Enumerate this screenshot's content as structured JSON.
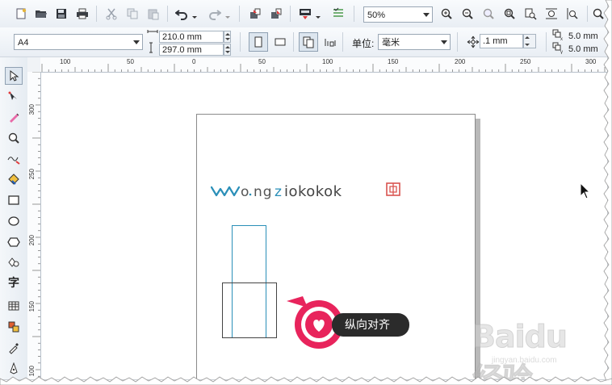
{
  "toolbar1": {
    "zoom_value": "50%",
    "icons": [
      "new-document-icon",
      "open-icon",
      "save-icon",
      "print-icon",
      "cut-icon",
      "copy-icon",
      "paste-icon",
      "undo-icon",
      "redo-icon",
      "import-icon",
      "export-icon",
      "app-launcher-icon",
      "options-icon",
      "zoom-in-icon",
      "zoom-out-icon",
      "zoom-selected-icon",
      "zoom-all-icon",
      "zoom-page-icon",
      "zoom-width-icon",
      "zoom-height-icon"
    ]
  },
  "toolbar2": {
    "paper_size": "A4",
    "width_value": "210.0 mm",
    "height_value": "297.0 mm",
    "units_label": "单位:",
    "units_value": "毫米",
    "nudge_value": ".1 mm",
    "dup_x_value": "5.0 mm",
    "dup_y_value": "5.0 mm"
  },
  "ruler_h": {
    "ticks": [
      "100",
      "50",
      "0",
      "50",
      "100",
      "150",
      "200",
      "250",
      "300"
    ]
  },
  "ruler_v": {
    "ticks": [
      "300",
      "250",
      "200",
      "150",
      "100"
    ]
  },
  "toolbox": {
    "tools": [
      "pick-tool-icon",
      "shape-tool-icon",
      "smart-fill-icon",
      "zoom-tool-icon",
      "freehand-tool-icon",
      "fill-tool-icon",
      "rectangle-tool-icon",
      "ellipse-tool-icon",
      "polygon-tool-icon",
      "shape-group-icon",
      "text-tool-icon",
      "table-tool-icon",
      "interactive-tool-icon",
      "eyedropper-tool-icon",
      "outline-tool-icon"
    ],
    "text_tool_glyph": "字"
  },
  "canvas": {
    "watermark_text": "wongziokokok",
    "tooltip_label": "纵向对齐",
    "baidu_main": "Baidu 经验",
    "baidu_sub": "jingyan.baidu.com"
  },
  "colors": {
    "accent_blue": "#2a8fb8",
    "tooltip_pink": "#e8245c",
    "logo_red": "#d9534f"
  }
}
